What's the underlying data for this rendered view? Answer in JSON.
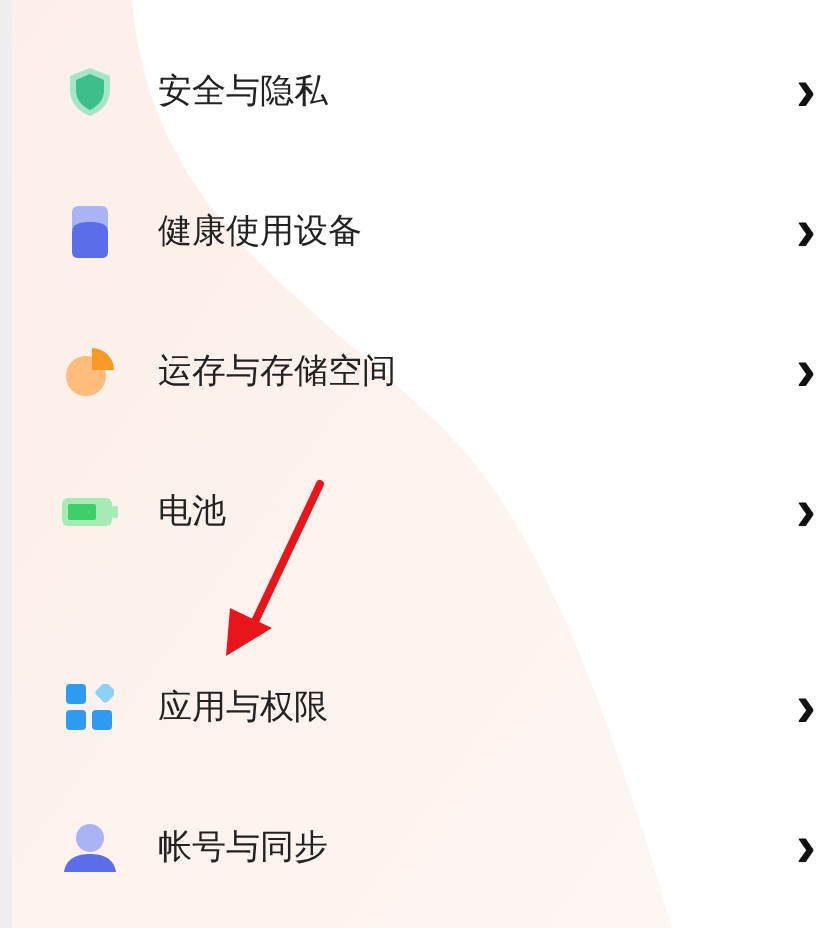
{
  "sections": [
    {
      "items": [
        {
          "kind": "shield",
          "label": "安全与隐私",
          "chevron": "›"
        },
        {
          "kind": "device",
          "label": "健康使用设备",
          "chevron": "›"
        },
        {
          "kind": "storage",
          "label": "运存与存储空间",
          "chevron": "›"
        },
        {
          "kind": "battery",
          "label": "电池",
          "chevron": "›"
        }
      ]
    },
    {
      "items": [
        {
          "kind": "apps",
          "label": "应用与权限",
          "chevron": "›"
        },
        {
          "kind": "account",
          "label": "帐号与同步",
          "chevron": "›"
        }
      ]
    }
  ]
}
